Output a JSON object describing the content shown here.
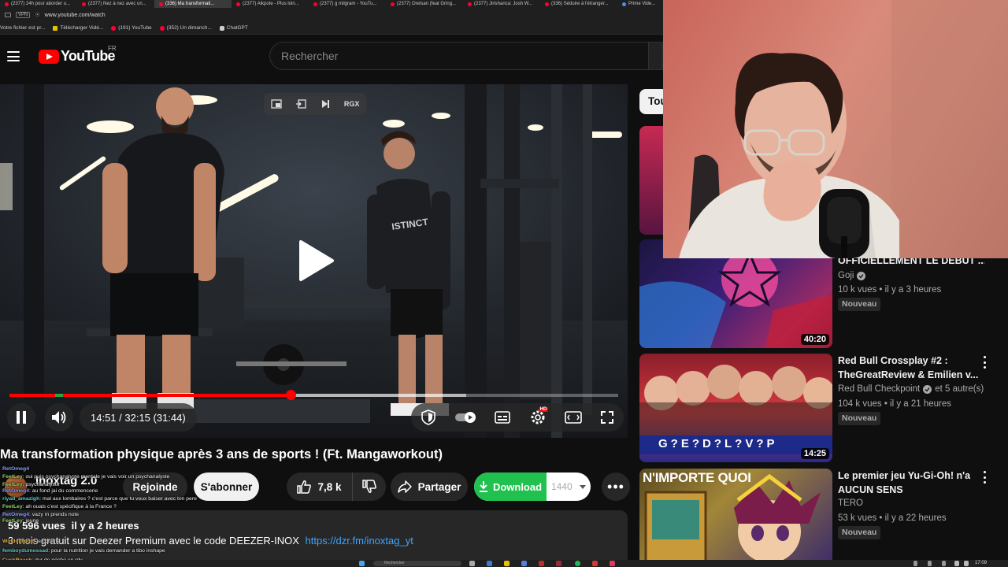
{
  "browser": {
    "tabs": [
      {
        "label": "(2377) 24h pour aborder u...",
        "active": false
      },
      {
        "label": "(2377) Nez à nez avec un...",
        "active": false
      },
      {
        "label": "(336) Ma transformati...",
        "active": true
      },
      {
        "label": "(2377) Alkpote - Plus loin...",
        "active": false
      },
      {
        "label": "(2377) g milgram - YouTu...",
        "active": false
      },
      {
        "label": "(2377) Orelsan (feat Gring...",
        "active": false
      },
      {
        "label": "(2377) Jirishanca: Josh W...",
        "active": false
      },
      {
        "label": "(336) Séduire à l'étranger...",
        "active": false
      },
      {
        "label": "Prime Vide...",
        "active": false
      }
    ],
    "vpn_label": "VPN",
    "url": "www.youtube.com/watch",
    "bookmarks": [
      "Votre fichier est pr...",
      "Télécharger Vidé...",
      "(191) YouTube",
      "(352) Un dimanch...",
      "ChatGPT"
    ]
  },
  "header": {
    "logo_text": "YouTube",
    "country_code": "FR",
    "search_placeholder": "Rechercher"
  },
  "player": {
    "time_current": "14:51",
    "time_total": "32:15",
    "time_remaining_label": "(31:44)",
    "time_display": "14:51 / 32:15 (31:44)",
    "progress_played": 0.462,
    "progress_buffered": 0.75,
    "top_controls_label": "RGX",
    "hd_badge": "HD"
  },
  "video": {
    "title": "Ma transformation physique après 3 ans de sports ! (Ft. Mangaworkout)",
    "channel": "Inoxtag 2.0",
    "join_label": "Rejoinde",
    "subscribe_label": "S'abonner",
    "likes": "7,8 k",
    "share_label": "Partager",
    "download_label": "Download",
    "download_resolution": "1440",
    "views": "59 596 vues",
    "published": "il y a 2 heures",
    "description_text": "3 mois gratuit sur Deezer Premium avec le code DEEZER-INOX",
    "description_link": "https://dzr.fm/inoxtag_yt"
  },
  "chat": [
    {
      "user": "RetOmeg4",
      "text": "",
      "cls": "a"
    },
    {
      "user": "FeetLey",
      "text": ": oui puis psychanalyste mentale je vais voir un psychanalyste",
      "cls": ""
    },
    {
      "user": "FeetLey",
      "text": ": psychanalyste",
      "cls": ""
    },
    {
      "user": "RetOmeg4",
      "text": ": au fond jai du commencerie",
      "cls": "a"
    },
    {
      "user": "riyad_amazigh",
      "text": ": mal aux lombaires ? c'est parce que tu veux baiser avec ton pere",
      "cls": "c"
    },
    {
      "user": "FeetLey",
      "text": ": ah ouais c'est spécifique à la France ?",
      "cls": ""
    },
    {
      "user": "RetOmeg4",
      "text": ": vazy m prends note",
      "cls": "a"
    },
    {
      "user": "FeetLey",
      "text": ": jeune",
      "cls": ""
    },
    {
      "user": "Woldoprodd",
      "text": ": je comme",
      "cls": "b"
    },
    {
      "user": "femboydumossad",
      "text": ": pour la nutrition je vais demander a tibo inshape",
      "cls": "c"
    },
    {
      "user": "CuckRoach",
      "text": ": dur de pécho un rdv",
      "cls": "b"
    }
  ],
  "rail": {
    "chip_label": "Tout",
    "videos": [
      {
        "title": "OFFICIELLEMENT LE DEBUT ...",
        "channel": "Goji",
        "verified": true,
        "meta": "10 k vues • il y a 3 heures",
        "badge": "Nouveau",
        "duration": "40:20"
      },
      {
        "title": "Red Bull Crossplay #2 : TheGreatReview & Emilien v...",
        "channel": "Red Bull Checkpoint",
        "verified": true,
        "channel_extra": "et 5 autre(s)",
        "meta": "104 k vues • il y a 21 heures",
        "badge": "Nouveau",
        "duration": "14:25",
        "thumb_text": "G?E?D?L?V?P"
      },
      {
        "title": "Le premier jeu Yu-Gi-Oh! n'a AUCUN SENS",
        "channel": "TERO",
        "verified": false,
        "meta": "53 k vues • il y a 22 heures",
        "badge": "Nouveau",
        "thumb_text": "N'IMPORTE QUOI"
      }
    ]
  },
  "taskbar": {
    "search_placeholder": "Rechercher",
    "clock": "17:09"
  },
  "colors": {
    "accent_red": "#ff0000",
    "download_green": "#21c14f",
    "link_blue": "#3ea6ff",
    "background": "#0f0f0f"
  }
}
